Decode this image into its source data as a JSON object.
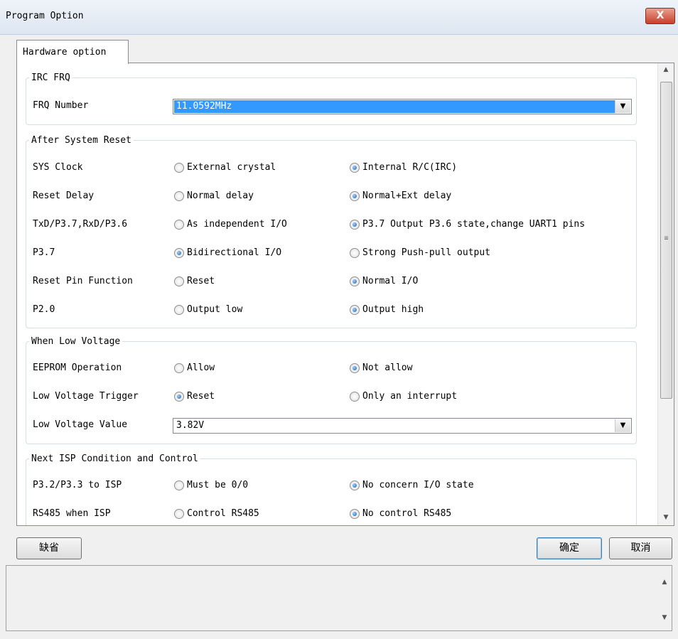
{
  "window": {
    "title": "Program Option",
    "close_label": "X"
  },
  "tab": {
    "label": "Hardware option"
  },
  "irc_frq": {
    "legend": "IRC FRQ",
    "label": "FRQ Number",
    "value": "11.0592MHz"
  },
  "after_reset": {
    "legend": "After System Reset",
    "rows": [
      {
        "label": "SYS Clock",
        "opt1": "External crystal",
        "opt2": "Internal R/C(IRC)",
        "selected": 2
      },
      {
        "label": "Reset Delay",
        "opt1": "Normal delay",
        "opt2": "Normal+Ext delay",
        "selected": 2
      },
      {
        "label": "TxD/P3.7,RxD/P3.6",
        "opt1": "As independent I/O",
        "opt2": "P3.7 Output P3.6 state,change UART1 pins",
        "selected": 2
      },
      {
        "label": "P3.7",
        "opt1": "Bidirectional I/O",
        "opt2": "Strong Push-pull output",
        "selected": 1
      },
      {
        "label": "Reset Pin Function",
        "opt1": "Reset",
        "opt2": "Normal I/O",
        "selected": 2
      },
      {
        "label": "P2.0",
        "opt1": "Output low",
        "opt2": "Output high",
        "selected": 2
      }
    ]
  },
  "low_voltage": {
    "legend": "When Low Voltage",
    "rows": [
      {
        "label": "EEPROM Operation",
        "opt1": "Allow",
        "opt2": "Not allow",
        "selected": 2
      },
      {
        "label": "Low Voltage Trigger",
        "opt1": "Reset",
        "opt2": "Only an interrupt",
        "selected": 1
      }
    ],
    "value_label": "Low Voltage Value",
    "value": "3.82V"
  },
  "next_isp": {
    "legend": "Next ISP Condition and Control",
    "rows": [
      {
        "label": "P3.2/P3.3 to ISP",
        "opt1": "Must be 0/0",
        "opt2": "No concern I/O state",
        "selected": 2
      },
      {
        "label": "RS485 when ISP",
        "opt1": "Control RS485",
        "opt2": "No control RS485",
        "selected": 2
      }
    ]
  },
  "buttons": {
    "default": "缺省",
    "ok": "确定",
    "cancel": "取消"
  },
  "icons": {
    "scroll_up": "scroll-up-icon",
    "scroll_down": "scroll-down-icon",
    "dropdown": "dropdown-arrow-icon",
    "close": "close-icon"
  }
}
